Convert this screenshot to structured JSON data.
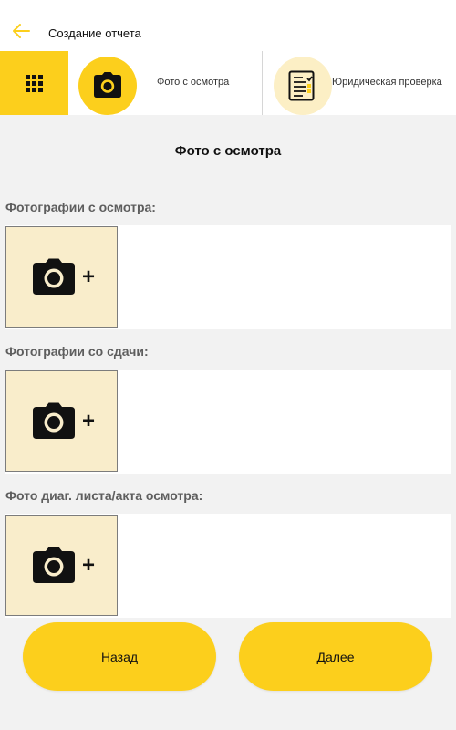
{
  "header": {
    "title": "Создание отчета"
  },
  "steps": [
    {
      "label": "Фото с осмотра",
      "icon": "camera-icon",
      "active": true
    },
    {
      "label": "Юридическая проверка",
      "icon": "checklist-icon",
      "active": false
    }
  ],
  "section": {
    "title": "Фото с осмотра"
  },
  "photo_groups": [
    {
      "label": "Фотографии с осмотра:",
      "add_symbol": "+"
    },
    {
      "label": "Фотографии со сдачи:",
      "add_symbol": "+"
    },
    {
      "label": "Фото диаг. листа/акта осмотра:",
      "add_symbol": "+"
    }
  ],
  "buttons": {
    "back": "Назад",
    "next": "Далее"
  },
  "colors": {
    "accent": "#fccf1c",
    "accent_light": "#fcefc5",
    "tile_bg": "#f9edcb",
    "page_bg": "#f2f2f2"
  }
}
